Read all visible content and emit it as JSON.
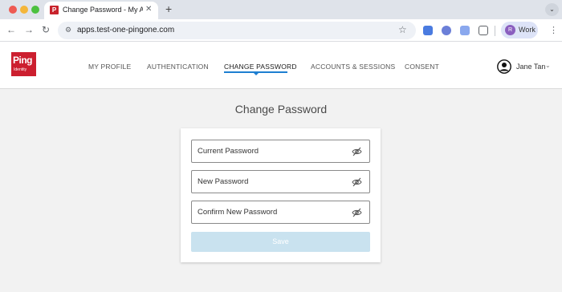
{
  "browser": {
    "tab_favicon": "P",
    "tab_title": "Change Password - My Account",
    "new_tab_symbol": "+",
    "url": "apps.test-one-pingone.com",
    "profile_initial": "R",
    "profile_label": "Work"
  },
  "logo": {
    "name": "Ping",
    "sub": "Identity",
    "color": "#cc1f2f"
  },
  "nav": {
    "items": [
      {
        "label": "MY PROFILE",
        "active": false
      },
      {
        "label": "AUTHENTICATION",
        "active": false
      },
      {
        "label": "CHANGE PASSWORD",
        "active": true
      },
      {
        "label": "ACCOUNTS & SESSIONS",
        "active": false
      },
      {
        "label": "CONSENT",
        "active": false
      }
    ],
    "accent_color": "#1e7fd1"
  },
  "user": {
    "name": "Jane Tan"
  },
  "main": {
    "title": "Change Password",
    "fields": [
      {
        "label": "Current Password",
        "icon": "eye-off-icon"
      },
      {
        "label": "New Password",
        "icon": "eye-off-icon"
      },
      {
        "label": "Confirm New Password",
        "icon": "eye-off-icon"
      }
    ],
    "save_label": "Save",
    "save_disabled": true,
    "save_color": "#c9e2ef"
  }
}
